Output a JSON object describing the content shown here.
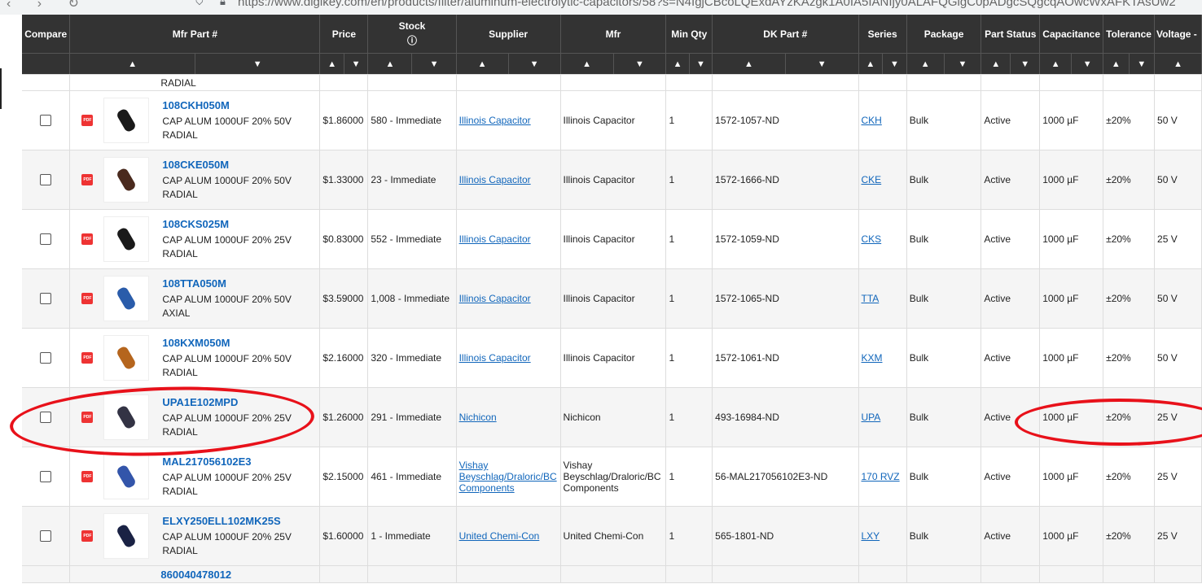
{
  "browser": {
    "url": "https://www.digikey.com/en/products/filter/aluminum-electrolytic-capacitors/58?s=N4IgjCBcoLQExdAYzKAzgk1A0IA5IANIjy0ALAFQGlgC0pADgcSQgcqAOwcWxAFKTAsUw2"
  },
  "table": {
    "headers": [
      "Compare",
      "Mfr Part #",
      "Price",
      "Stock",
      "Supplier",
      "Mfr",
      "Min Qty",
      "DK Part #",
      "Series",
      "Package",
      "Part Status",
      "Capacitance",
      "Tolerance",
      "Voltage -"
    ],
    "stock_help_icon": "question-circle-icon",
    "sort_up_glyph": "⌃",
    "sort_down_glyph": "⌄",
    "top_partial_text": "RADIAL",
    "rows": [
      {
        "part": "108CKH050M",
        "desc": "CAP ALUM 1000UF 20% 50V RADIAL",
        "price": "$1.86000",
        "stock": "580 - Immediate",
        "supplier": "Illinois Capacitor",
        "mfr": "Illinois Capacitor",
        "minqty": "1",
        "dk": "1572-1057-ND",
        "series": "CKH",
        "package": "Bulk",
        "status": "Active",
        "cap": "1000 µF",
        "tol": "±20%",
        "volt": "50 V",
        "img_color": "#1a1a1a"
      },
      {
        "part": "108CKE050M",
        "desc": "CAP ALUM 1000UF 20% 50V RADIAL",
        "price": "$1.33000",
        "stock": "23 - Immediate",
        "supplier": "Illinois Capacitor",
        "mfr": "Illinois Capacitor",
        "minqty": "1",
        "dk": "1572-1666-ND",
        "series": "CKE",
        "package": "Bulk",
        "status": "Active",
        "cap": "1000 µF",
        "tol": "±20%",
        "volt": "50 V",
        "img_color": "#4a2a1e"
      },
      {
        "part": "108CKS025M",
        "desc": "CAP ALUM 1000UF 20% 25V RADIAL",
        "price": "$0.83000",
        "stock": "552 - Immediate",
        "supplier": "Illinois Capacitor",
        "mfr": "Illinois Capacitor",
        "minqty": "1",
        "dk": "1572-1059-ND",
        "series": "CKS",
        "package": "Bulk",
        "status": "Active",
        "cap": "1000 µF",
        "tol": "±20%",
        "volt": "25 V",
        "img_color": "#1a1a1a"
      },
      {
        "part": "108TTA050M",
        "desc": "CAP ALUM 1000UF 20% 50V AXIAL",
        "price": "$3.59000",
        "stock": "1,008 - Immediate",
        "supplier": "Illinois Capacitor",
        "mfr": "Illinois Capacitor",
        "minqty": "1",
        "dk": "1572-1065-ND",
        "series": "TTA",
        "package": "Bulk",
        "status": "Active",
        "cap": "1000 µF",
        "tol": "±20%",
        "volt": "50 V",
        "img_color": "#2a5caa"
      },
      {
        "part": "108KXM050M",
        "desc": "CAP ALUM 1000UF 20% 50V RADIAL",
        "price": "$2.16000",
        "stock": "320 - Immediate",
        "supplier": "Illinois Capacitor",
        "mfr": "Illinois Capacitor",
        "minqty": "1",
        "dk": "1572-1061-ND",
        "series": "KXM",
        "package": "Bulk",
        "status": "Active",
        "cap": "1000 µF",
        "tol": "±20%",
        "volt": "50 V",
        "img_color": "#b5651d"
      },
      {
        "part": "UPA1E102MPD",
        "desc": "CAP ALUM 1000UF 20% 25V RADIAL",
        "price": "$1.26000",
        "stock": "291 - Immediate",
        "supplier": "Nichicon",
        "mfr": "Nichicon",
        "minqty": "1",
        "dk": "493-16984-ND",
        "series": "UPA",
        "package": "Bulk",
        "status": "Active",
        "cap": "1000 µF",
        "tol": "±20%",
        "volt": "25 V",
        "img_color": "#333344"
      },
      {
        "part": "MAL217056102E3",
        "desc": "CAP ALUM 1000UF 20% 25V RADIAL",
        "price": "$2.15000",
        "stock": "461 - Immediate",
        "supplier": "Vishay Beyschlag/Draloric/BC Components",
        "mfr": "Vishay Beyschlag/Draloric/BC Components",
        "minqty": "1",
        "dk": "56-MAL217056102E3-ND",
        "series": "170 RVZ",
        "package": "Bulk",
        "status": "Active",
        "cap": "1000 µF",
        "tol": "±20%",
        "volt": "25 V",
        "img_color": "#3355aa"
      },
      {
        "part": "ELXY250ELL102MK25S",
        "desc": "CAP ALUM 1000UF 20% 25V RADIAL",
        "price": "$1.60000",
        "stock": "1 - Immediate",
        "supplier": "United Chemi-Con",
        "mfr": "United Chemi-Con",
        "minqty": "1",
        "dk": "565-1801-ND",
        "series": "LXY",
        "package": "Bulk",
        "status": "Active",
        "cap": "1000 µF",
        "tol": "±20%",
        "volt": "25 V",
        "img_color": "#1a2244"
      }
    ],
    "bottom_partial_part": "860040478012"
  },
  "annotations": {
    "circle_color": "#e8111a"
  }
}
